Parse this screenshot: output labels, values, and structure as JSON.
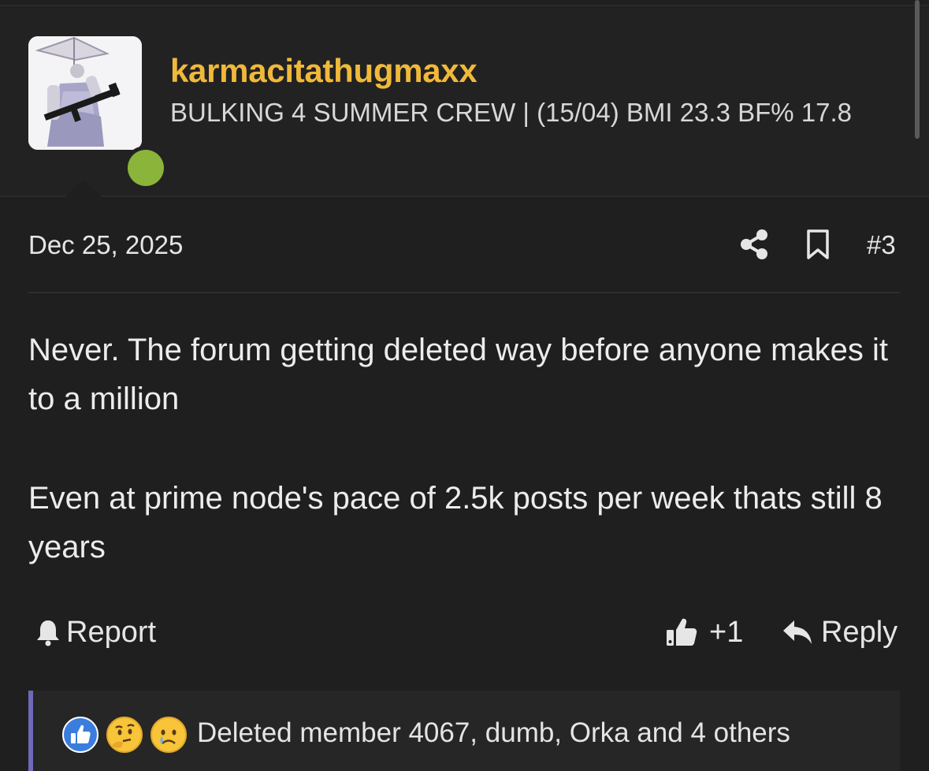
{
  "user": {
    "username": "karmacitathugmaxx",
    "title": "BULKING 4 SUMMER CREW | (15/04) BMI 23.3 BF% 17.8",
    "online": true,
    "username_color": "#f0b93a",
    "online_color": "#8ab43a"
  },
  "post": {
    "date": "Dec 25, 2025",
    "number": "#3",
    "paragraphs": [
      "Never. The forum getting deleted way before anyone makes it to a million",
      "Even at prime node's pace of 2.5k posts per week thats still 8 years"
    ]
  },
  "actions": {
    "report_label": "Report",
    "like_count": "+1",
    "reply_label": "Reply"
  },
  "reactions": {
    "icons": [
      "like-reaction-icon",
      "thinking-face-icon",
      "crying-face-icon"
    ],
    "summary": "Deleted member 4067, dumb, Orka and 4 others",
    "accent_color": "#6e6ab8"
  }
}
